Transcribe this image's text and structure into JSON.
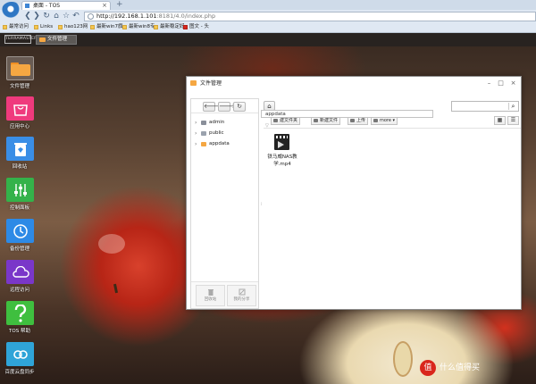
{
  "browser": {
    "tab_title": "桌面 - TOS",
    "tab_close": "×",
    "new_tab": "+",
    "url_main": "http://192.168.1.101",
    "url_rest": ":8181/4.0/index.php",
    "bookmarks": [
      {
        "label": "最常访问"
      },
      {
        "label": "Links"
      },
      {
        "label": "hao123网"
      },
      {
        "label": "最新win7旗"
      },
      {
        "label": "最新win8专"
      },
      {
        "label": "最新稳定好"
      },
      {
        "label": "图文 - 头"
      }
    ],
    "nav_glyphs": {
      "back": "❮",
      "forward": "❯",
      "reload": "↻",
      "home": "⌂",
      "star": "☆",
      "history": "↶"
    }
  },
  "tos_bar": {
    "logo": "TERRAMASTER",
    "task_item": "文件管理"
  },
  "desktop": {
    "icons": [
      {
        "label": "文件管理",
        "color": "#f5a742",
        "icon": "folder-icon"
      },
      {
        "label": "应用中心",
        "color": "#ef3a7d",
        "icon": "shopping-bag-icon"
      },
      {
        "label": "回收站",
        "color": "#3a8ee6",
        "icon": "recycle-bin-icon"
      },
      {
        "label": "控制面板",
        "color": "#34b24a",
        "icon": "control-panel-icon"
      },
      {
        "label": "备份管理",
        "color": "#2d8ae6",
        "icon": "clock-icon"
      },
      {
        "label": "远程访问",
        "color": "#7a37c9",
        "icon": "cloud-icon"
      },
      {
        "label": "TOS 帮助",
        "color": "#3fbf3f",
        "icon": "question-icon"
      },
      {
        "label": "百度云盘同步",
        "color": "#2fa4d8",
        "icon": "baidu-cloud-icon"
      }
    ],
    "watermark": {
      "badge": "值",
      "text": "什么值得买"
    }
  },
  "file_manager": {
    "title": "文件管理",
    "win_controls": {
      "minimize": "–",
      "maximize": "□",
      "close": "×"
    },
    "nav": {
      "back": "🡐",
      "forward": "🡒",
      "refresh": "↻"
    },
    "tree": [
      {
        "label": "admin",
        "color": "#8a8f9a"
      },
      {
        "label": "public",
        "color": "#9aa2ad"
      },
      {
        "label": "appdata",
        "color": "#f5a742"
      }
    ],
    "footer": {
      "recycle": "回收站",
      "share": "我的分享"
    },
    "home": "⌂",
    "search_icon": "⌕",
    "path": "appdata",
    "toolbar": [
      {
        "label": "建文件夹"
      },
      {
        "label": "新建文件"
      },
      {
        "label": "上传"
      },
      {
        "label": "more ▾"
      }
    ],
    "view": {
      "grid": "▦",
      "list": "☰"
    },
    "sort_arrow": "▽",
    "files": [
      {
        "name": "铁马威NAS教学.mp4",
        "icon": "video-file-icon"
      }
    ]
  }
}
